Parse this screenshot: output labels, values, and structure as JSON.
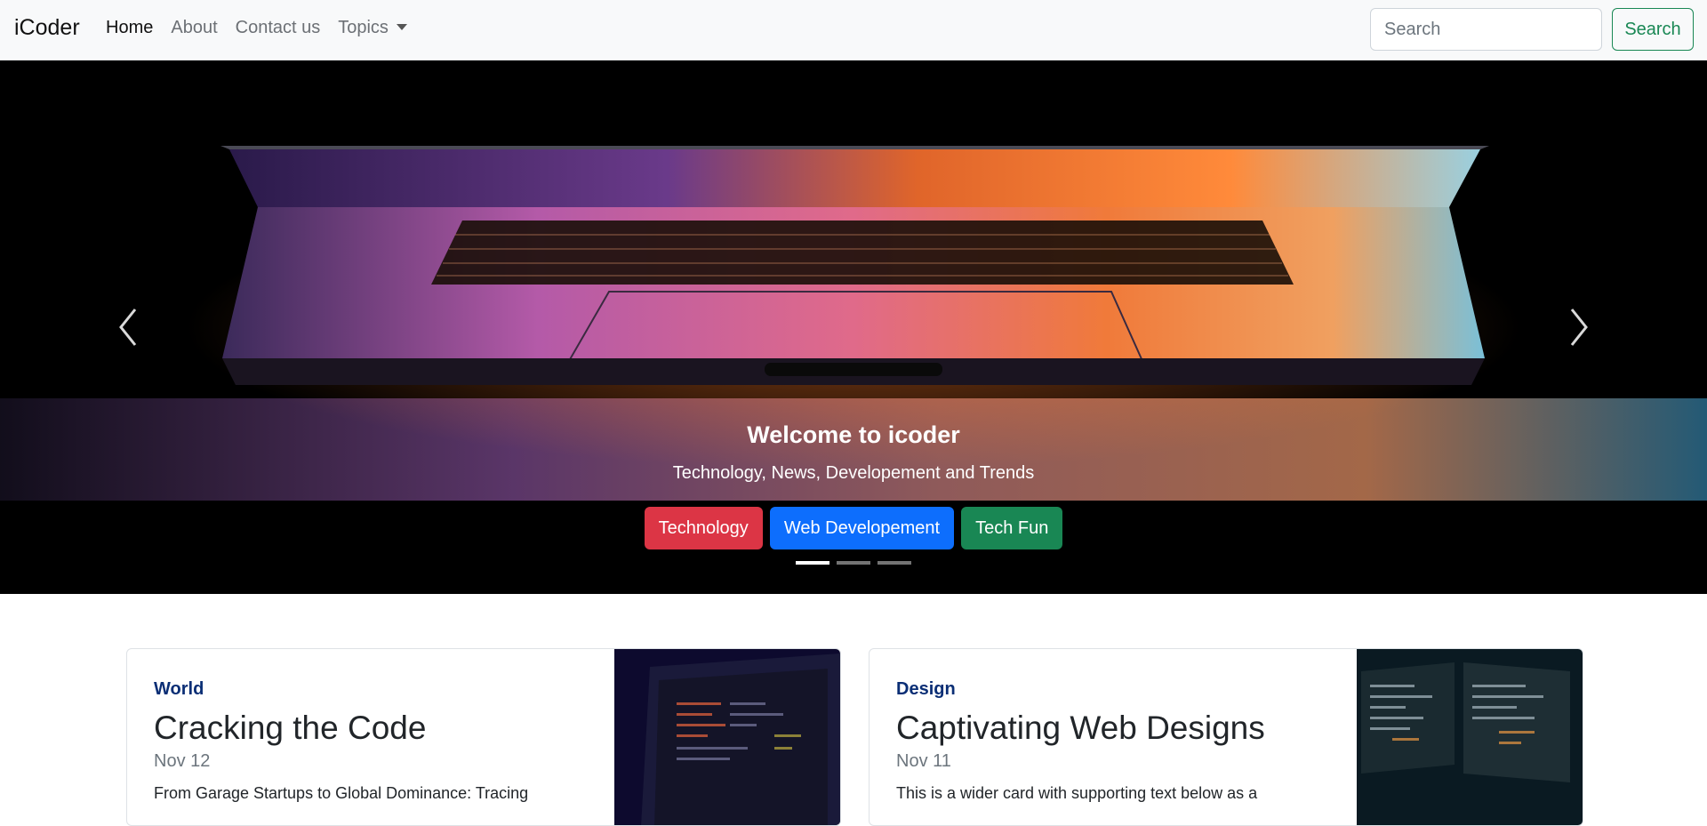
{
  "navbar": {
    "brand": "iCoder",
    "links": [
      {
        "label": "Home",
        "active": true
      },
      {
        "label": "About",
        "active": false
      },
      {
        "label": "Contact us",
        "active": false
      },
      {
        "label": "Topics",
        "active": false
      }
    ],
    "search_placeholder": "Search",
    "search_button": "Search"
  },
  "carousel": {
    "caption_title": "Welcome to icoder",
    "caption_text": "Technology, News, Developement and Trends",
    "buttons": [
      "Technology",
      "Web Developement",
      "Tech Fun"
    ],
    "active_slide": 1,
    "slide_count": 3,
    "prev_icon": "chevron-left-icon",
    "next_icon": "chevron-right-icon"
  },
  "cards": [
    {
      "category": "World",
      "title": "Cracking the Code",
      "date": "Nov 12",
      "text": "From Garage Startups to Global Dominance: Tracing"
    },
    {
      "category": "Design",
      "title": "Captivating Web Designs",
      "date": "Nov 11",
      "text": "This is a wider card with supporting text below as a"
    }
  ],
  "colors": {
    "success": "#198754",
    "danger": "#dc3545",
    "primary": "#0d6efd",
    "category": "#0a2e75"
  }
}
